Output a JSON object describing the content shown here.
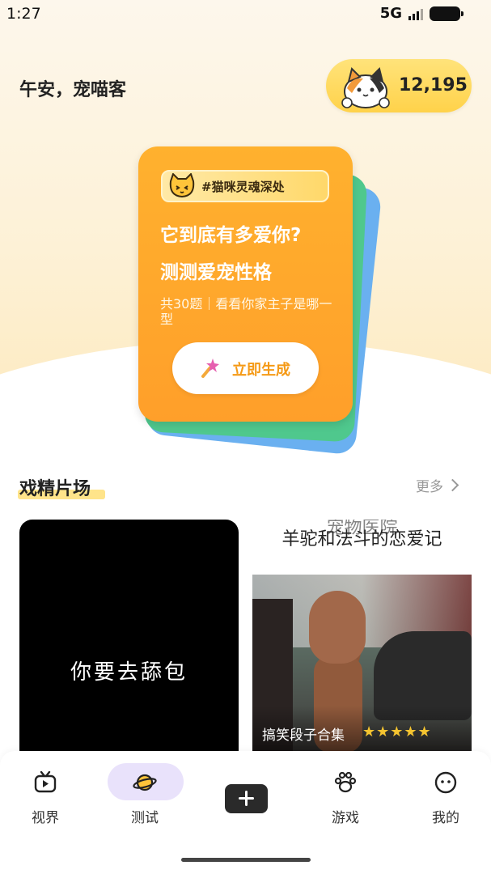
{
  "status_bar": {
    "time": "1:27",
    "network": "5G"
  },
  "header": {
    "greeting": "午安，宠喵客",
    "coins": "12,195"
  },
  "quiz_card": {
    "tag": "#猫咪灵魂深处",
    "title_line1": "它到底有多爱你?",
    "title_line2": "测测爱宠性格",
    "description": "共30题｜看看你家主子是哪一型",
    "button_label": "立即生成",
    "colors": {
      "main": "#ffa72c",
      "back_green": "#4fc88d",
      "back_blue": "#6ab0f0"
    }
  },
  "section": {
    "title": "戏精片场",
    "more_label": "更多"
  },
  "videos": [
    {
      "caption": "你要去舔包"
    },
    {
      "title_partial": "宠物医院",
      "title": "羊驼和法斗的恋爱记",
      "subtitle": "搞笑段子合集",
      "stars": "★★★★★"
    }
  ],
  "tabbar": {
    "tabs": [
      {
        "label": "视界",
        "icon": "tv-icon"
      },
      {
        "label": "测试",
        "icon": "planet-icon"
      },
      {
        "label": "",
        "icon": "plus-icon"
      },
      {
        "label": "游戏",
        "icon": "paw-icon"
      },
      {
        "label": "我的",
        "icon": "face-icon"
      }
    ],
    "active_tab": "测试"
  }
}
